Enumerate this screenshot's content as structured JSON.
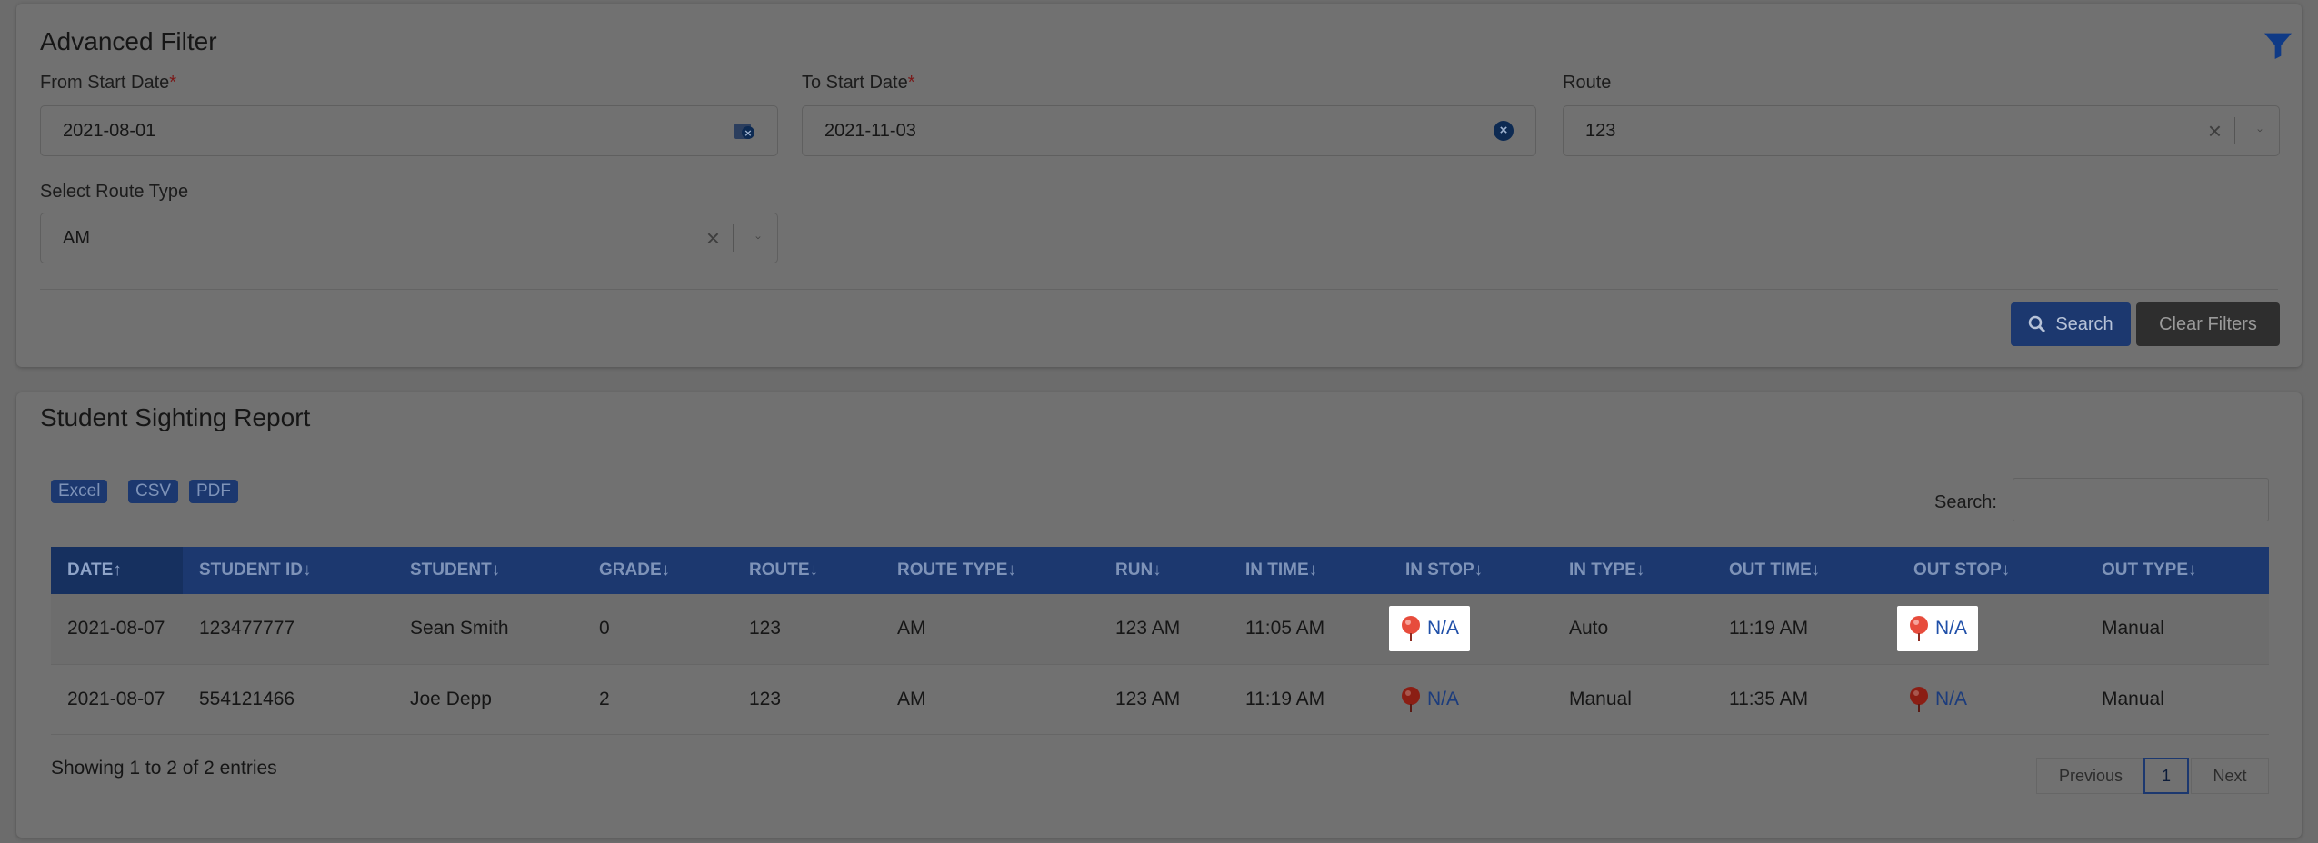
{
  "filter": {
    "title": "Advanced Filter",
    "from_label": "From Start Date",
    "from_value": "2021-08-01",
    "to_label": "To Start Date",
    "to_value": "2021-11-03",
    "required_mark": "*",
    "route_label": "Route",
    "route_value": "123",
    "route_type_label": "Select Route Type",
    "route_type_value": "AM",
    "clear_glyph": "×",
    "search_button": "Search",
    "clear_button": "Clear Filters"
  },
  "report": {
    "title": "Student Sighting Report",
    "exports": [
      "Excel",
      "CSV",
      "PDF"
    ],
    "search_label": "Search:",
    "search_value": "",
    "columns": [
      "DATE",
      "STUDENT ID",
      "STUDENT",
      "GRADE",
      "ROUTE",
      "ROUTE TYPE",
      "RUN",
      "IN TIME",
      "IN STOP",
      "IN TYPE",
      "OUT TIME",
      "OUT STOP",
      "OUT TYPE"
    ],
    "sort_up_glyph": "↑",
    "sort_down_glyph": "↓",
    "rows": [
      {
        "date": "2021-08-07",
        "student_id": "123477777",
        "student": "Sean Smith",
        "grade": "0",
        "route": "123",
        "route_type": "AM",
        "run": "123 AM",
        "in_time": "11:05 AM",
        "in_stop": "N/A",
        "in_type": "Auto",
        "out_time": "11:19 AM",
        "out_stop": "N/A",
        "out_type": "Manual"
      },
      {
        "date": "2021-08-07",
        "student_id": "554121466",
        "student": "Joe Depp",
        "grade": "2",
        "route": "123",
        "route_type": "AM",
        "run": "123 AM",
        "in_time": "11:19 AM",
        "in_stop": "N/A",
        "in_type": "Manual",
        "out_time": "11:35 AM",
        "out_stop": "N/A",
        "out_type": "Manual"
      }
    ],
    "showing_text": "Showing 1 to 2 of 2 entries",
    "pager": {
      "previous": "Previous",
      "page": "1",
      "next": "Next"
    }
  },
  "icons": {
    "filter": "filter-funnel-icon",
    "search": "magnifier-icon",
    "stop_marker": "map-pin-icon",
    "calendar": "calendar-icon"
  },
  "colors": {
    "accent": "#1c386f",
    "link": "#1f4fa8",
    "pin": "#c0392b",
    "required": "#7a1818"
  }
}
